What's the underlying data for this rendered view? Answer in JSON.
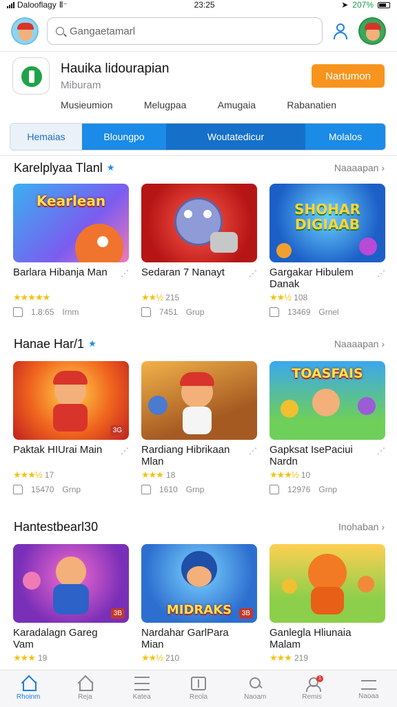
{
  "status_bar": {
    "carrier": "Dalooflagy",
    "network": "Ⅱ⁻",
    "time": "23:25",
    "battery_pct": "207%"
  },
  "search": {
    "placeholder": "Gangaetamarl",
    "value": "Gangaetamarl"
  },
  "featured_app": {
    "title": "Hauika lidourapian",
    "subtitle": "Miburam",
    "action_label": "Nartumon"
  },
  "subnav": [
    "Musieumion",
    "Melugpaa",
    "Amugaia",
    "Rabanatien"
  ],
  "tabs": [
    "Hemaias",
    "Bloungpo",
    "Woutatedicur",
    "Molalos"
  ],
  "sections": [
    {
      "title": "Karelplyaa Tlanl",
      "see_all": "Naaaapan",
      "cards": [
        {
          "thumb_text": "Kearlean",
          "title": "Barlara Hibanja Man",
          "rating": "",
          "rating_value": 5,
          "stat_count": "1.8:65",
          "stat_label": "Irnm",
          "badge": ""
        },
        {
          "thumb_text": "",
          "title": "Sedaran 7 Nanayt",
          "rating": "215",
          "rating_value": 2.5,
          "stat_count": "7451",
          "stat_label": "Grup",
          "badge": ""
        },
        {
          "thumb_text": "SHOHAR DIGIAAB",
          "title": "Gargakar Hibulem Danak",
          "rating": "108",
          "rating_value": 2.5,
          "stat_count": "13469",
          "stat_label": "Grnel",
          "badge": ""
        }
      ]
    },
    {
      "title": "Hanae Har/1",
      "see_all": "Naaaapan",
      "cards": [
        {
          "thumb_text": "",
          "title": "Paktak HIUrai Main",
          "rating": "17",
          "rating_value": 3.5,
          "stat_count": "15470",
          "stat_label": "Grnp",
          "badge": "3G"
        },
        {
          "thumb_text": "",
          "title": "Rardiang Hibrikaan Mlan",
          "rating": "18",
          "rating_value": 3,
          "stat_count": "1610",
          "stat_label": "Grnp",
          "badge": ""
        },
        {
          "thumb_text": "TOASFAIS",
          "title": "Gapksat IsePaciui Nardn",
          "rating": "10",
          "rating_value": 3.5,
          "stat_count": "12976",
          "stat_label": "Grnp",
          "badge": ""
        }
      ]
    },
    {
      "title": "Hantestbearl30",
      "see_all": "Inohaban",
      "cards": [
        {
          "thumb_text": "",
          "title": "Karadalagn Gareg Vam",
          "rating": "19",
          "rating_value": 3,
          "stat_count": "",
          "stat_label": "",
          "badge": "3B"
        },
        {
          "thumb_text": "MIDRAKS",
          "title": "Nardahar GarlPara Mian",
          "rating": "210",
          "rating_value": 2.5,
          "stat_count": "",
          "stat_label": "",
          "badge": "3B"
        },
        {
          "thumb_text": "",
          "title": "Ganlegla Hliunaia Malam",
          "rating": "219",
          "rating_value": 3,
          "stat_count": "",
          "stat_label": "",
          "badge": ""
        }
      ]
    }
  ],
  "bottom_nav": [
    {
      "label": "Rhoinm",
      "icon": "home-icon"
    },
    {
      "label": "Reja",
      "icon": "house-icon"
    },
    {
      "label": "Katea",
      "icon": "list-icon"
    },
    {
      "label": "Reola",
      "icon": "grid-icon"
    },
    {
      "label": "Naoam",
      "icon": "search-icon"
    },
    {
      "label": "Remis",
      "icon": "user-icon"
    },
    {
      "label": "Naoaa",
      "icon": "menu-icon"
    }
  ],
  "notification_count": "1",
  "colors": {
    "accent": "#1a8be6",
    "cta": "#f7941d",
    "star": "#f4c20d"
  }
}
